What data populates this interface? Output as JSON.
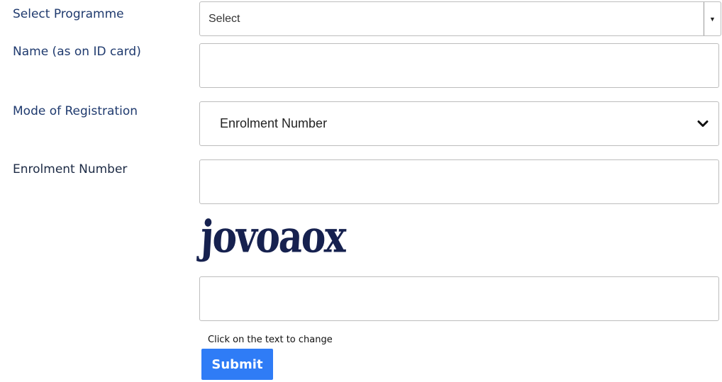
{
  "form": {
    "programme_label": "Select Programme",
    "programme_value": "Select",
    "name_label": "Name (as on ID card)",
    "name_value": "",
    "mode_label": "Mode of Registration",
    "mode_value": "Enrolment Number",
    "enrolment_label": "Enrolment Number",
    "enrolment_value": "",
    "captcha_text": "jovoaox",
    "captcha_input_value": "",
    "captcha_hint": "Click on the text to change",
    "submit_label": "Submit"
  },
  "colors": {
    "label": "#1f3a6e",
    "captcha": "#16214f",
    "submit_bg": "#2f7cf6"
  }
}
